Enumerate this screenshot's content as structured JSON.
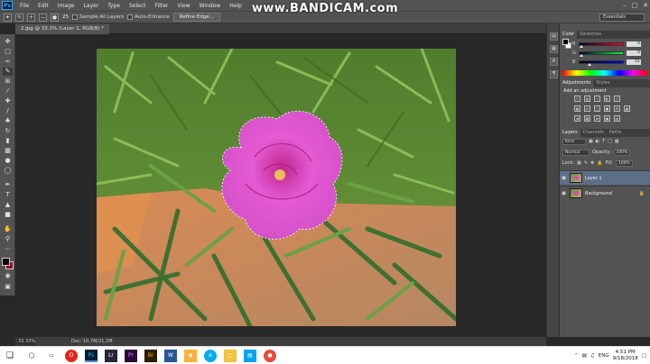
{
  "watermark": "www.BANDICAM.com",
  "menu": {
    "app_badge": "Ps",
    "items": [
      "File",
      "Edit",
      "Image",
      "Layer",
      "Type",
      "Select",
      "Filter",
      "View",
      "Window",
      "Help"
    ]
  },
  "options": {
    "brush_size": "25",
    "sample_all_layers": "Sample All Layers",
    "auto_enhance": "Auto-Enhance",
    "refine_edge": "Refine Edge...",
    "workspace": "Essentials"
  },
  "document": {
    "tab_label": "2.jpg @ 33.3% (Layer 1, RGB/8) *",
    "zoom": "33.33%",
    "doc_size": "Doc: 10,7M/21,2M"
  },
  "color_panel": {
    "tabs": [
      "Color",
      "Swatches"
    ],
    "channels": [
      {
        "label": "R",
        "value": "0",
        "color": "#ff0000"
      },
      {
        "label": "G",
        "value": "0",
        "color": "#00ff00"
      },
      {
        "label": "B",
        "value": "51",
        "color": "#0000ff"
      }
    ]
  },
  "adjustments_panel": {
    "tabs": [
      "Adjustments",
      "Styles"
    ],
    "title": "Add an adjustment"
  },
  "layers_panel": {
    "tabs": [
      "Layers",
      "Channels",
      "Paths"
    ],
    "kind_filter": "Kind",
    "blend_mode": "Normal",
    "opacity_label": "Opacity:",
    "opacity_value": "100%",
    "lock_label": "Lock:",
    "fill_label": "Fill:",
    "fill_value": "100%",
    "layers": [
      {
        "name": "Layer 1",
        "selected": true,
        "locked": false
      },
      {
        "name": "Background",
        "selected": false,
        "locked": true
      }
    ]
  },
  "taskbar": {
    "language": "ENG",
    "time": "4:51 PM",
    "date": "9/18/2018"
  },
  "colors": {
    "accent_selection": "#5d6f87",
    "foreground": "#0b0b0b",
    "background": "#8a1020"
  }
}
